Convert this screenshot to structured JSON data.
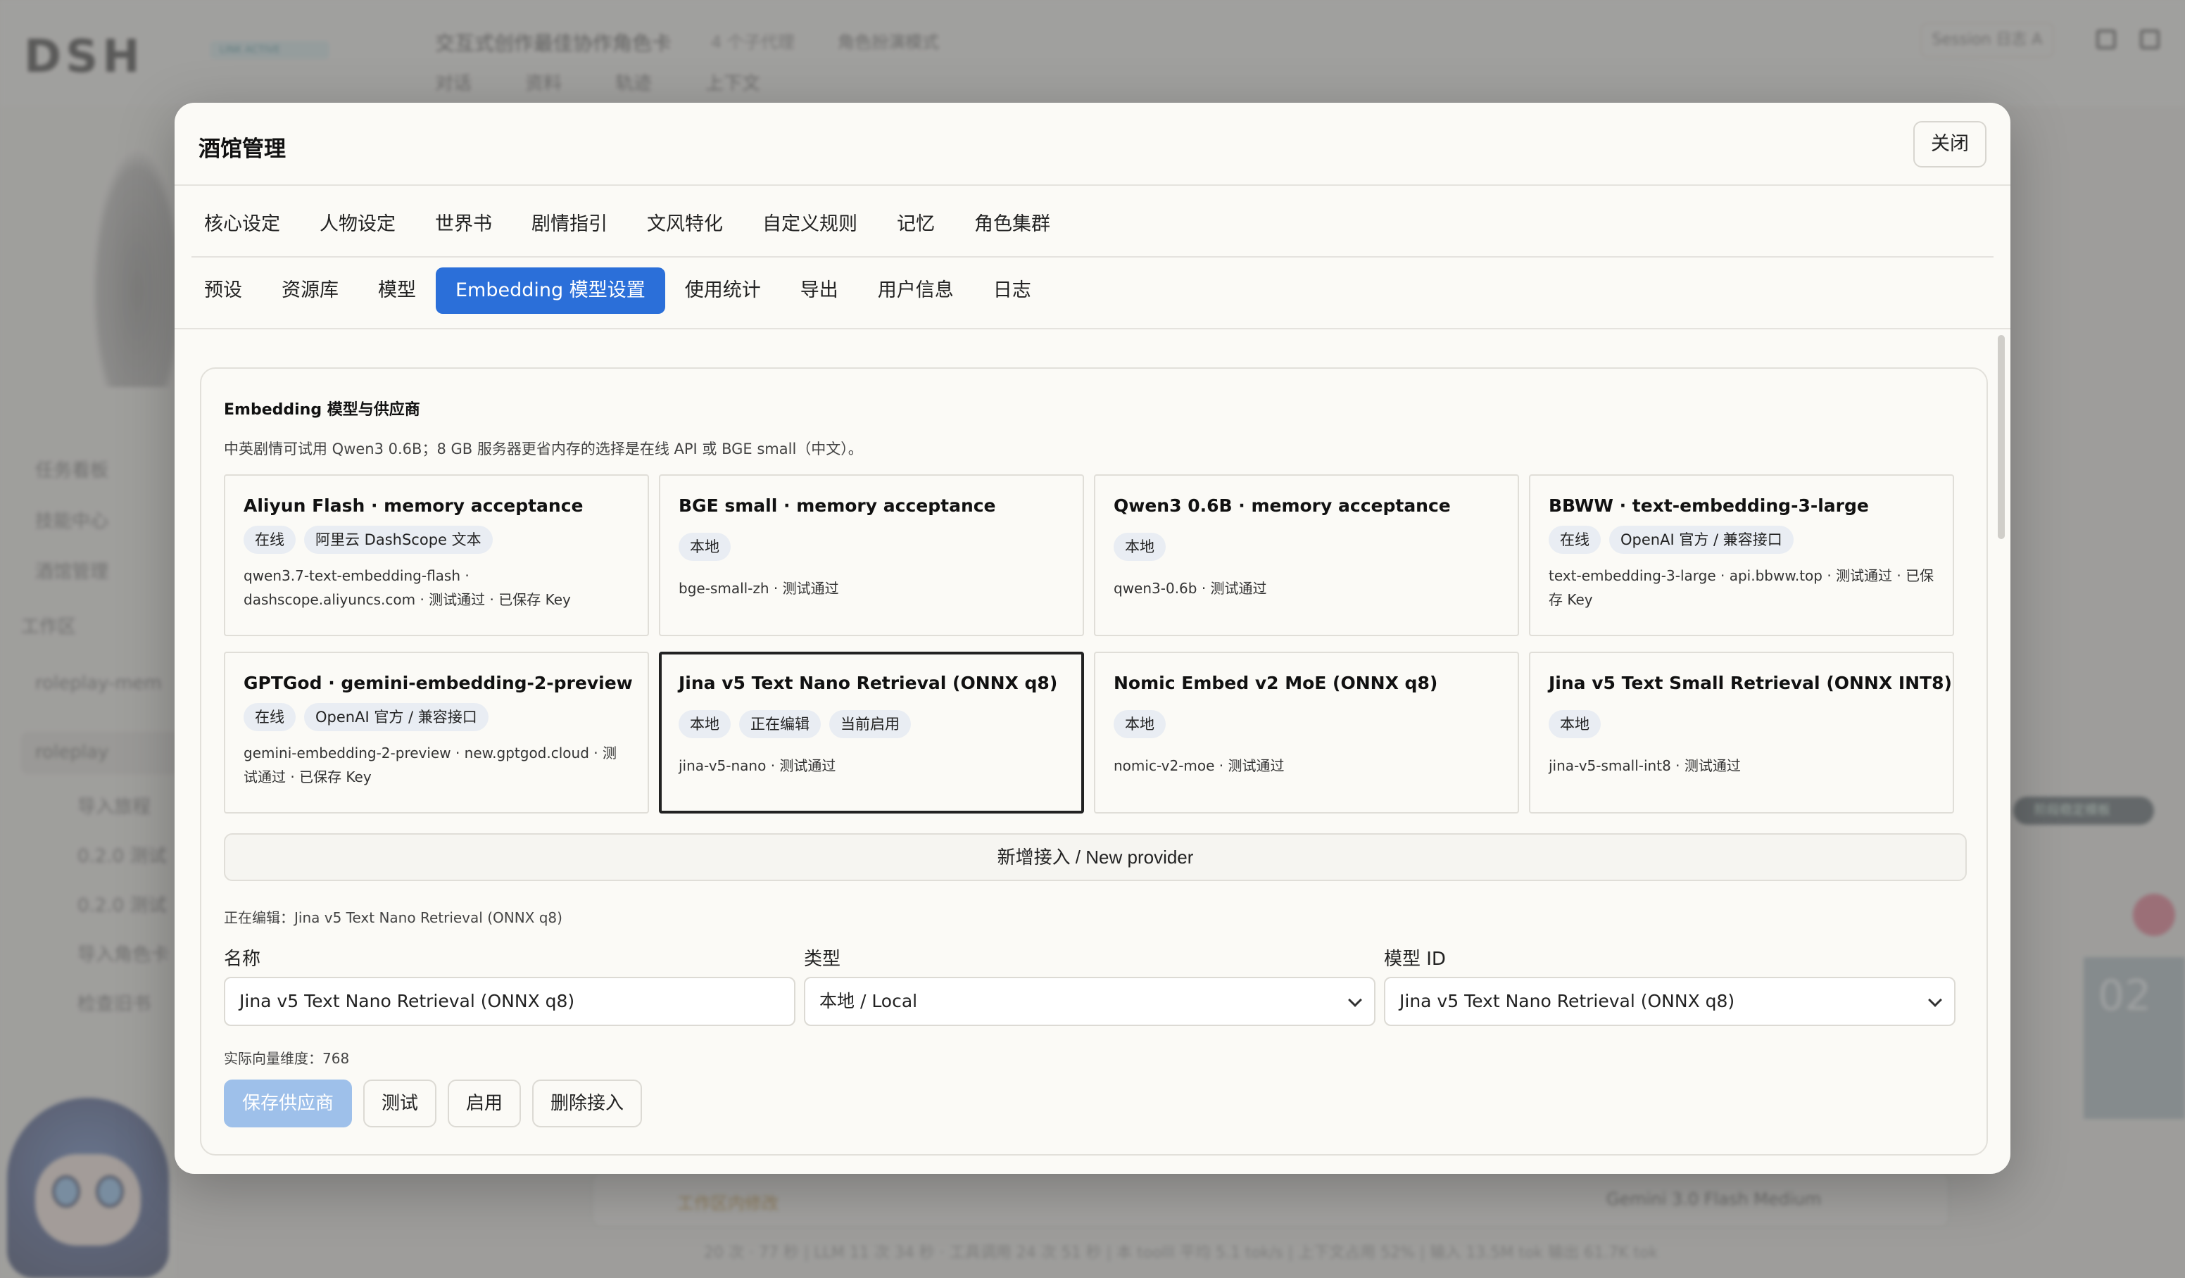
{
  "background": {
    "logo": "DSH",
    "logo_tag": "LINK ACTIVE",
    "title": "交互式创作最佳协作角色卡",
    "subtitle": "4 个子代理",
    "mode": "角色扮演模式",
    "tabs": [
      "对话",
      "资料",
      "轨迹",
      "上下文"
    ],
    "session": "Session 日志 A",
    "sidebar": [
      "任务看板",
      "技能中心",
      "酒馆管理",
      "工作区",
      "roleplay-mem",
      "roleplay",
      "导入旅程",
      "0.2.0 测试",
      "0.2.0 测试",
      "导入角色卡",
      "检查旧书"
    ],
    "bottom_chip": "工作区内修改",
    "model_pill": "Gemini 3.0 Flash Medium",
    "status_bar": "20 次 · 77 秒 | LLM 11 次 34 秒 · 工具调用 24 次 51 秒 | 本 toolll 平均 5.1 tok/s | 上下文占用 52% | 输入 13.5M tok 输出 61.7K tok",
    "right_badge": "阶段稳定模板",
    "right_num": "02"
  },
  "modal": {
    "title": "酒馆管理",
    "close_label": "关闭",
    "tabs_row1": [
      "核心设定",
      "人物设定",
      "世界书",
      "剧情指引",
      "文风特化",
      "自定义规则",
      "记忆",
      "角色集群"
    ],
    "tabs_row2": [
      "预设",
      "资源库",
      "模型",
      "Embedding 模型设置",
      "使用统计",
      "导出",
      "用户信息",
      "日志"
    ],
    "active_tab": "Embedding 模型设置"
  },
  "panel": {
    "title": "Embedding 模型与供应商",
    "hint": "中英剧情可试用 Qwen3 0.6B；8 GB 服务器更省内存的选择是在线 API 或 BGE small（中文）。",
    "providers": [
      {
        "name": "Aliyun Flash · memory acceptance",
        "badges": [
          "在线",
          "阿里云 DashScope 文本"
        ],
        "meta": "qwen3.7-text-embedding-flash · dashscope.aliyuncs.com · 测试通过 · 已保存 Key"
      },
      {
        "name": "BGE small · memory acceptance",
        "badges": [
          "本地"
        ],
        "meta": "bge-small-zh · 测试通过"
      },
      {
        "name": "Qwen3 0.6B · memory acceptance",
        "badges": [
          "本地"
        ],
        "meta": "qwen3-0.6b · 测试通过"
      },
      {
        "name": "BBWW · text-embedding-3-large",
        "badges": [
          "在线",
          "OpenAI 官方 / 兼容接口"
        ],
        "meta": "text-embedding-3-large · api.bbww.top · 测试通过 · 已保存 Key"
      },
      {
        "name": "GPTGod · gemini-embedding-2-preview",
        "badges": [
          "在线",
          "OpenAI 官方 / 兼容接口"
        ],
        "meta": "gemini-embedding-2-preview · new.gptgod.cloud · 测试通过 · 已保存 Key"
      },
      {
        "name": "Jina v5 Text Nano Retrieval (ONNX q8)",
        "badges": [
          "本地",
          "正在编辑",
          "当前启用"
        ],
        "meta": "jina-v5-nano · 测试通过"
      },
      {
        "name": "Nomic Embed v2 MoE (ONNX q8)",
        "badges": [
          "本地"
        ],
        "meta": "nomic-v2-moe · 测试通过"
      },
      {
        "name": "Jina v5 Text Small Retrieval (ONNX INT8)",
        "badges": [
          "本地"
        ],
        "meta": "jina-v5-small-int8 · 测试通过"
      }
    ],
    "new_provider_label": "新增接入 / New provider",
    "editing_label": "正在编辑：Jina v5 Text Nano Retrieval (ONNX q8)",
    "form": {
      "name_label": "名称",
      "name_value": "Jina v5 Text Nano Retrieval (ONNX q8)",
      "type_label": "类型",
      "type_value": "本地 / Local",
      "model_label": "模型 ID",
      "model_value": "Jina v5 Text Nano Retrieval (ONNX q8)"
    },
    "dimension_label": "实际向量维度：768",
    "actions": {
      "save": "保存供应商",
      "test": "测试",
      "enable": "启用",
      "delete": "删除接入"
    }
  }
}
